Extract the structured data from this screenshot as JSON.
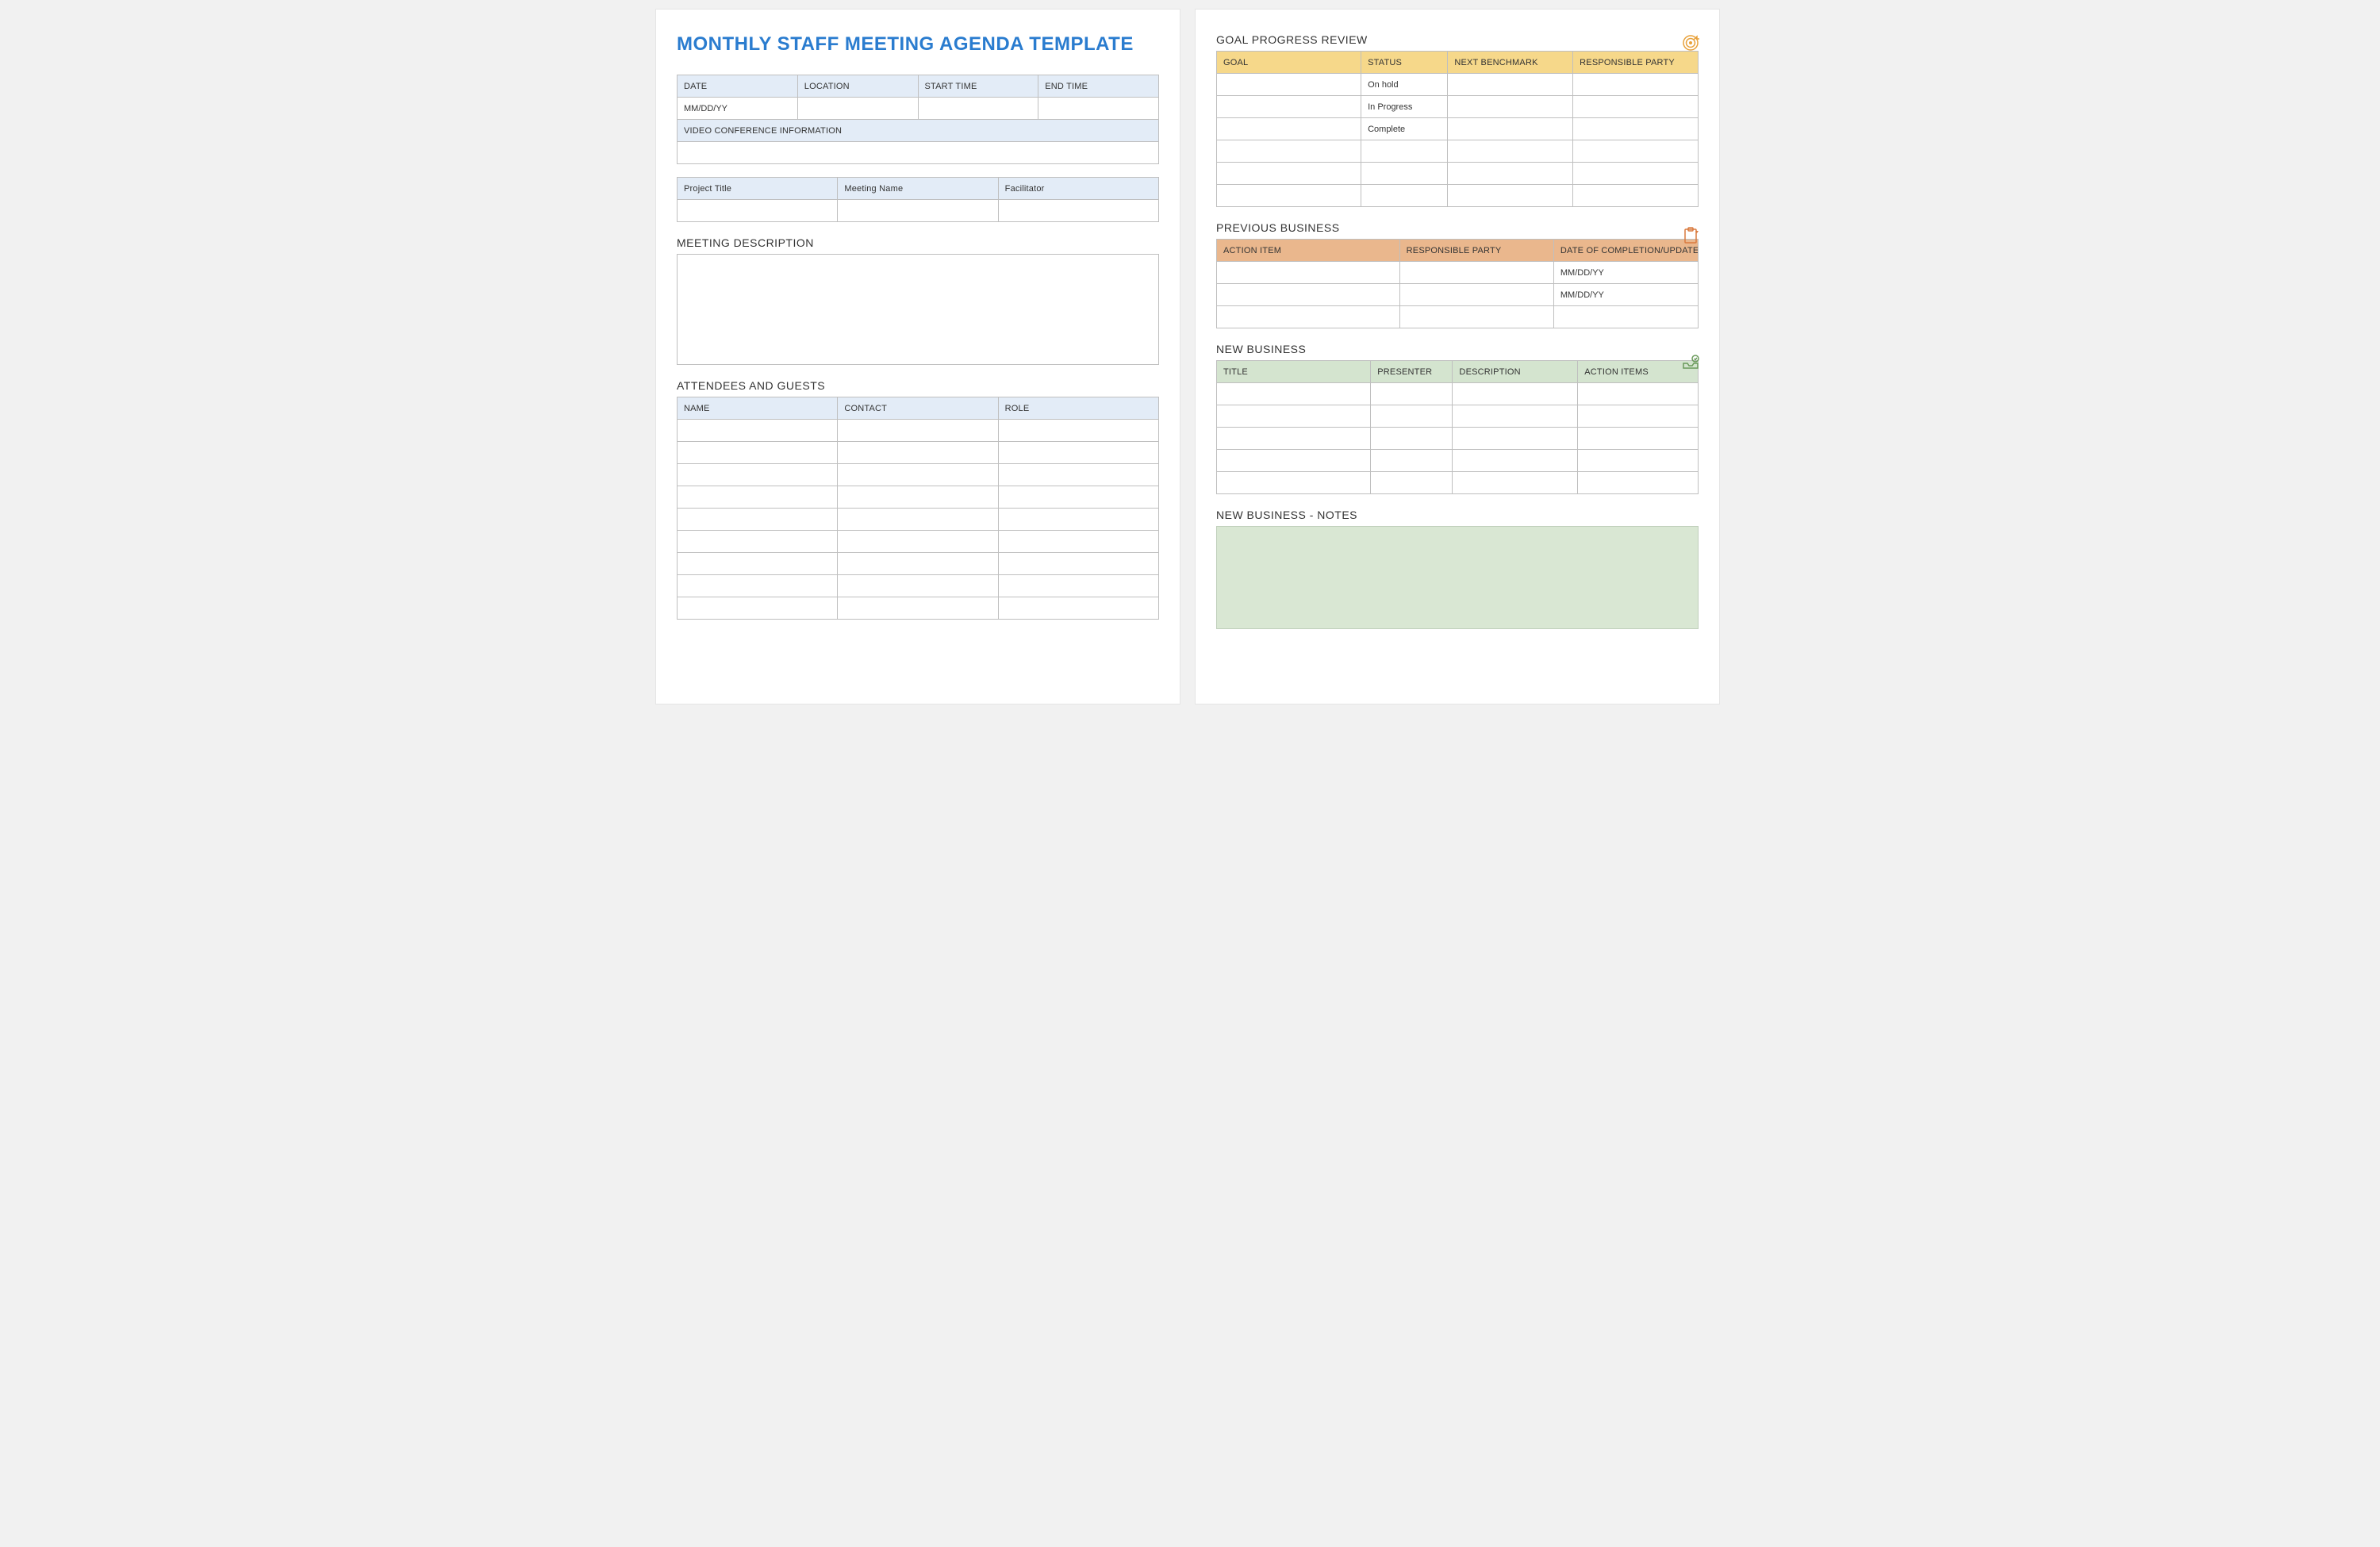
{
  "left": {
    "title": "MONTHLY STAFF MEETING AGENDA TEMPLATE",
    "meeting_info": {
      "headers": [
        "DATE",
        "LOCATION",
        "START TIME",
        "END TIME"
      ],
      "values": [
        "MM/DD/YY",
        "",
        "",
        ""
      ],
      "video_header": "VIDEO CONFERENCE INFORMATION",
      "video_value": ""
    },
    "project_info": {
      "headers": [
        "Project Title",
        "Meeting Name",
        "Facilitator"
      ],
      "values": [
        "",
        "",
        ""
      ]
    },
    "meeting_desc_label": "MEETING DESCRIPTION",
    "attendees_label": "ATTENDEES AND GUESTS",
    "attendees": {
      "headers": [
        "NAME",
        "CONTACT",
        "ROLE"
      ],
      "rows": [
        [
          "",
          "",
          ""
        ],
        [
          "",
          "",
          ""
        ],
        [
          "",
          "",
          ""
        ],
        [
          "",
          "",
          ""
        ],
        [
          "",
          "",
          ""
        ],
        [
          "",
          "",
          ""
        ],
        [
          "",
          "",
          ""
        ],
        [
          "",
          "",
          ""
        ],
        [
          "",
          "",
          ""
        ]
      ]
    }
  },
  "right": {
    "goal_label": "GOAL PROGRESS REVIEW",
    "goal": {
      "headers": [
        "GOAL",
        "STATUS",
        "NEXT BENCHMARK",
        "RESPONSIBLE PARTY"
      ],
      "rows": [
        [
          "",
          "On hold",
          "",
          ""
        ],
        [
          "",
          "In Progress",
          "",
          ""
        ],
        [
          "",
          "Complete",
          "",
          ""
        ],
        [
          "",
          "",
          "",
          ""
        ],
        [
          "",
          "",
          "",
          ""
        ],
        [
          "",
          "",
          "",
          ""
        ]
      ]
    },
    "prev_label": "PREVIOUS BUSINESS",
    "prev": {
      "headers": [
        "ACTION ITEM",
        "RESPONSIBLE PARTY",
        "DATE OF COMPLETION/UPDATE"
      ],
      "rows": [
        [
          "",
          "",
          "MM/DD/YY"
        ],
        [
          "",
          "",
          "MM/DD/YY"
        ],
        [
          "",
          "",
          ""
        ]
      ]
    },
    "new_label": "NEW BUSINESS",
    "new": {
      "headers": [
        "TITLE",
        "PRESENTER",
        "DESCRIPTION",
        "ACTION ITEMS"
      ],
      "rows": [
        [
          "",
          "",
          "",
          ""
        ],
        [
          "",
          "",
          "",
          ""
        ],
        [
          "",
          "",
          "",
          ""
        ],
        [
          "",
          "",
          "",
          ""
        ],
        [
          "",
          "",
          "",
          ""
        ]
      ]
    },
    "notes_label": "NEW BUSINESS - NOTES"
  }
}
